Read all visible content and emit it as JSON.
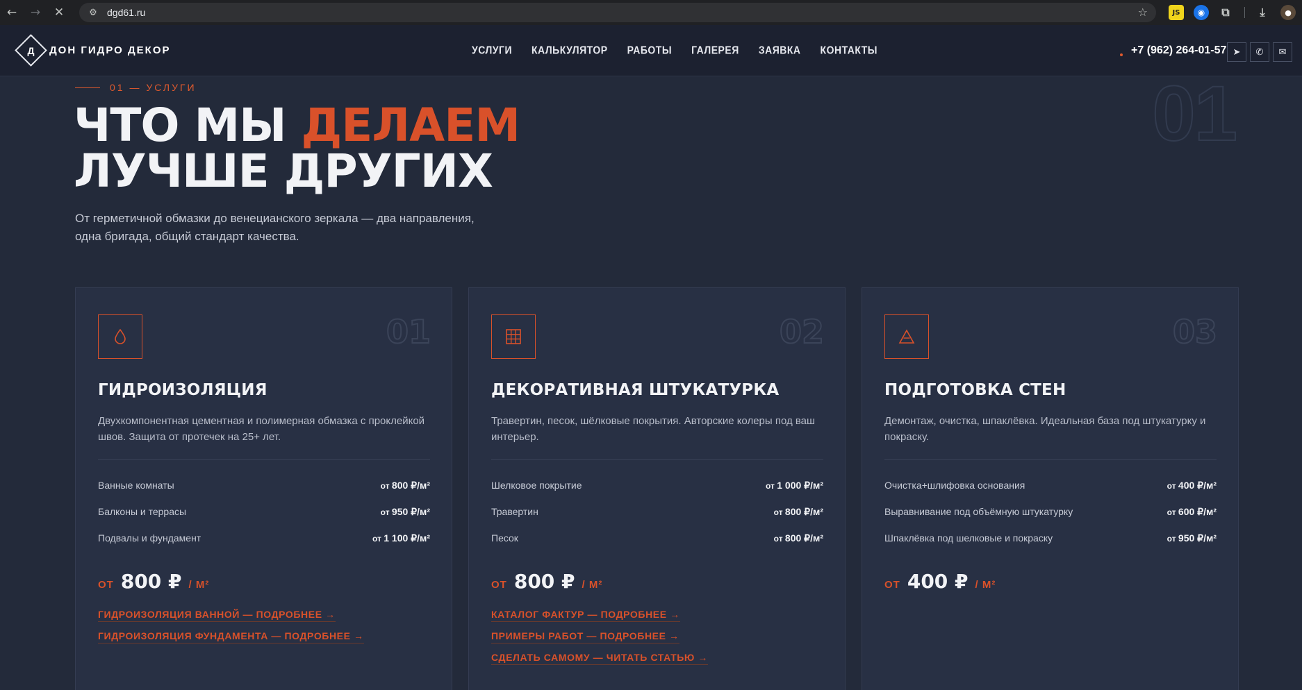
{
  "browser": {
    "url": "dgd61.ru",
    "back_icon": "arrow-left-icon",
    "forward_icon": "arrow-right-icon",
    "stop_icon": "close-icon"
  },
  "header": {
    "logo_letter": "Д",
    "logo_text": "ДОН ГИДРО ДЕКОР",
    "nav": [
      "УСЛУГИ",
      "КАЛЬКУЛЯТОР",
      "РАБОТЫ",
      "ГАЛЕРЕЯ",
      "ЗАЯВКА",
      "КОНТАКТЫ"
    ],
    "phone": "+7 (962) 264-01-57",
    "social_icons": [
      "telegram-icon",
      "whatsapp-icon",
      "chat-icon"
    ]
  },
  "hero": {
    "eyebrow": "01 — УСЛУГИ",
    "big_number": "01",
    "title_part1": "ЧТО МЫ ",
    "title_accent": "ДЕЛАЕМ",
    "title_line2": "ЛУЧШЕ ДРУГИХ",
    "subtitle_line1": "От герметичной обмазки до венецианского зеркала — два направления,",
    "subtitle_line2": "одна бригада, общий стандарт качества."
  },
  "cards": [
    {
      "number": "01",
      "icon": "drop-icon",
      "title": "ГИДРОИЗОЛЯЦИЯ",
      "desc": "Двухкомпонентная цементная и полимерная обмазка с проклейкой швов. Защита от протечек на 25+ лет.",
      "prices": [
        {
          "label": "Ванные комнаты",
          "pre": "от ",
          "value": "800 ₽/м²"
        },
        {
          "label": "Балконы и террасы",
          "pre": "от ",
          "value": "950 ₽/м²"
        },
        {
          "label": "Подвалы и фундамент",
          "pre": "от ",
          "value": "1 100 ₽/м²"
        }
      ],
      "from": "ОТ",
      "amount": "800 ₽",
      "unit": "/ М²",
      "links": [
        "ГИДРОИЗОЛЯЦИЯ ВАННОЙ — ПОДРОБНЕЕ →",
        "ГИДРОИЗОЛЯЦИЯ ФУНДАМЕНТА — ПОДРОБНЕЕ →"
      ]
    },
    {
      "number": "02",
      "icon": "grid-icon",
      "title": "ДЕКОРАТИВНАЯ ШТУКАТУРКА",
      "desc": "Травертин, песок, шёлковые покрытия. Авторские колеры под ваш интерьер.",
      "prices": [
        {
          "label": "Шелковое покрытие",
          "pre": "от ",
          "value": "1 000 ₽/м²"
        },
        {
          "label": "Травертин",
          "pre": "от ",
          "value": "800 ₽/м²"
        },
        {
          "label": "Песок",
          "pre": "от ",
          "value": "800 ₽/м²"
        }
      ],
      "from": "ОТ",
      "amount": "800 ₽",
      "unit": "/ М²",
      "links": [
        "КАТАЛОГ ФАКТУР — ПОДРОБНЕЕ →",
        "ПРИМЕРЫ РАБОТ — ПОДРОБНЕЕ →",
        "СДЕЛАТЬ САМОМУ — ЧИТАТЬ СТАТЬЮ →"
      ]
    },
    {
      "number": "03",
      "icon": "triangle-icon",
      "title": "ПОДГОТОВКА СТЕН",
      "desc": "Демонтаж, очистка, шпаклёвка. Идеальная база под штукатурку и покраску.",
      "prices": [
        {
          "label": "Очистка+шлифовка основания",
          "pre": "от ",
          "value": "400 ₽/м²"
        },
        {
          "label": "Выравнивание под объёмную штукатурку",
          "pre": "от ",
          "value": "600 ₽/м²"
        },
        {
          "label": "Шпаклёвка под шелковые и покраску",
          "pre": "от ",
          "value": "950 ₽/м²"
        }
      ],
      "from": "ОТ",
      "amount": "400 ₽",
      "unit": "/ М²",
      "links": []
    }
  ],
  "colors": {
    "accent": "#d9512a",
    "background": "#232a3a",
    "card": "#283044",
    "header": "#1c2130"
  }
}
